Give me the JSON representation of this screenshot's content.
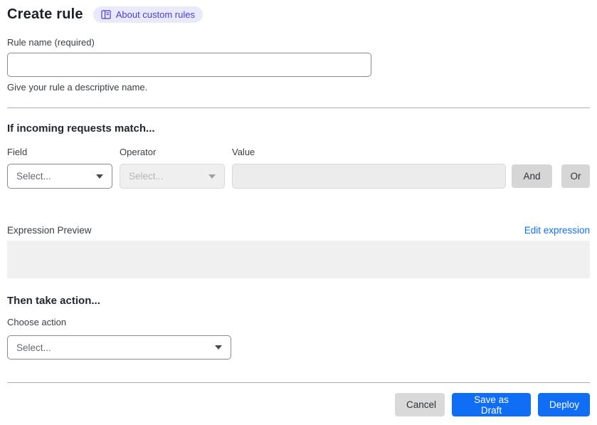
{
  "header": {
    "title": "Create rule",
    "about_badge_label": "About custom rules"
  },
  "rule_name": {
    "label": "Rule name (required)",
    "value": "",
    "helper": "Give your rule a descriptive name."
  },
  "match_section": {
    "heading": "If incoming requests match...",
    "field_label": "Field",
    "operator_label": "Operator",
    "value_label": "Value",
    "field_select_value": "Select...",
    "operator_select_value": "Select...",
    "value_input_value": "",
    "and_button_label": "And",
    "or_button_label": "Or"
  },
  "expression": {
    "label": "Expression Preview",
    "edit_link_label": "Edit expression",
    "preview_content": ""
  },
  "action_section": {
    "heading": "Then take action...",
    "choose_label": "Choose action",
    "select_value": "Select..."
  },
  "footer": {
    "cancel_label": "Cancel",
    "save_draft_label": "Save as Draft",
    "deploy_label": "Deploy"
  },
  "icons": {
    "badge_icon": "book-icon",
    "select_caret": "chevron-down-icon"
  },
  "colors": {
    "primary_blue": "#106ef5",
    "link_blue": "#106ef5",
    "badge_bg": "#eae9fc",
    "badge_text": "#4741cd",
    "disabled_bg": "#ececec",
    "neutral_button_bg": "#d6d6d6",
    "preview_box_bg": "#f0f0f0"
  }
}
